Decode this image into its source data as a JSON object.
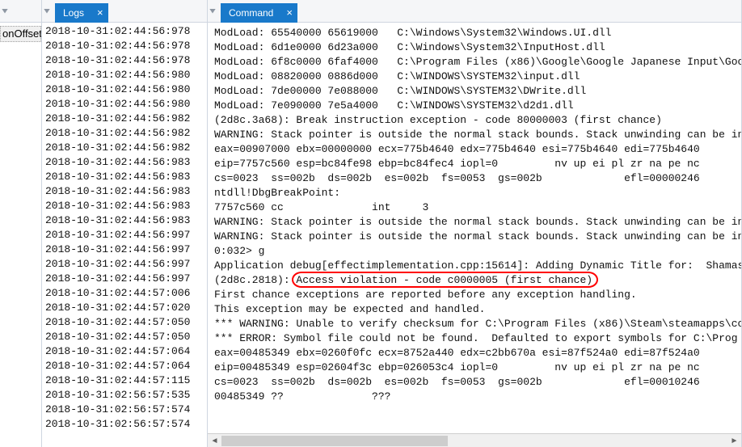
{
  "left_panel": {
    "items": [
      "",
      "onOffset"
    ],
    "selected_index": 1
  },
  "logs_panel": {
    "tab_label": "Logs",
    "lines": [
      "2018-10-31:02:44:56:978",
      "2018-10-31:02:44:56:978",
      "2018-10-31:02:44:56:978",
      "2018-10-31:02:44:56:980",
      "2018-10-31:02:44:56:980",
      "2018-10-31:02:44:56:980",
      "2018-10-31:02:44:56:982",
      "2018-10-31:02:44:56:982",
      "2018-10-31:02:44:56:982",
      "2018-10-31:02:44:56:983",
      "2018-10-31:02:44:56:983",
      "2018-10-31:02:44:56:983",
      "2018-10-31:02:44:56:983",
      "2018-10-31:02:44:56:983",
      "2018-10-31:02:44:56:997",
      "2018-10-31:02:44:56:997",
      "2018-10-31:02:44:56:997",
      "2018-10-31:02:44:56:997",
      "2018-10-31:02:44:57:006",
      "2018-10-31:02:44:57:020",
      "2018-10-31:02:44:57:050",
      "2018-10-31:02:44:57:050",
      "2018-10-31:02:44:57:064",
      "2018-10-31:02:44:57:064",
      "2018-10-31:02:44:57:115",
      "2018-10-31:02:56:57:535",
      "2018-10-31:02:56:57:574",
      "2018-10-31:02:56:57:574"
    ]
  },
  "command_panel": {
    "tab_label": "Command",
    "lines": [
      "ModLoad: 65540000 65619000   C:\\Windows\\System32\\Windows.UI.dll",
      "ModLoad: 6d1e0000 6d23a000   C:\\Windows\\System32\\InputHost.dll",
      "ModLoad: 6f8c0000 6faf4000   C:\\Program Files (x86)\\Google\\Google Japanese Input\\Goo",
      "ModLoad: 08820000 0886d000   C:\\WINDOWS\\SYSTEM32\\input.dll",
      "ModLoad: 7de00000 7e088000   C:\\WINDOWS\\SYSTEM32\\DWrite.dll",
      "ModLoad: 7e090000 7e5a4000   C:\\WINDOWS\\SYSTEM32\\d2d1.dll",
      "(2d8c.3a68): Break instruction exception - code 80000003 (first chance)",
      "WARNING: Stack pointer is outside the normal stack bounds. Stack unwinding can be in",
      "eax=00907000 ebx=00000000 ecx=775b4640 edx=775b4640 esi=775b4640 edi=775b4640",
      "eip=7757c560 esp=bc84fe98 ebp=bc84fec4 iopl=0         nv up ei pl zr na pe nc",
      "cs=0023  ss=002b  ds=002b  es=002b  fs=0053  gs=002b             efl=00000246",
      "ntdll!DbgBreakPoint:",
      "7757c560 cc              int     3",
      "WARNING: Stack pointer is outside the normal stack bounds. Stack unwinding can be in",
      "WARNING: Stack pointer is outside the normal stack bounds. Stack unwinding can be in",
      "0:032> g",
      "Application debug[effectimplementation.cpp:15614]: Adding Dynamic Title for:  Shamas",
      "",
      "(2d8c.2818): Access violation - code c0000005 (first chance)",
      "First chance exceptions are reported before any exception handling.",
      "This exception may be expected and handled.",
      "*** WARNING: Unable to verify checksum for C:\\Program Files (x86)\\Steam\\steamapps\\co",
      "*** ERROR: Symbol file could not be found.  Defaulted to export symbols for C:\\Prog",
      "eax=00485349 ebx=0260f0fc ecx=8752a440 edx=c2bb670a esi=87f524a0 edi=87f524a0",
      "eip=00485349 esp=02604f3c ebp=026053c4 iopl=0         nv up ei pl zr na pe nc",
      "cs=0023  ss=002b  ds=002b  es=002b  fs=0053  gs=002b             efl=00010246",
      "00485349 ??              ???"
    ],
    "highlight_line_index": 18,
    "highlight_text": "Access violation - code c0000005 (first chance)"
  },
  "colors": {
    "tab_active_bg": "#1979ca",
    "tab_active_fg": "#ffffff",
    "highlight_border": "#ff0000"
  }
}
